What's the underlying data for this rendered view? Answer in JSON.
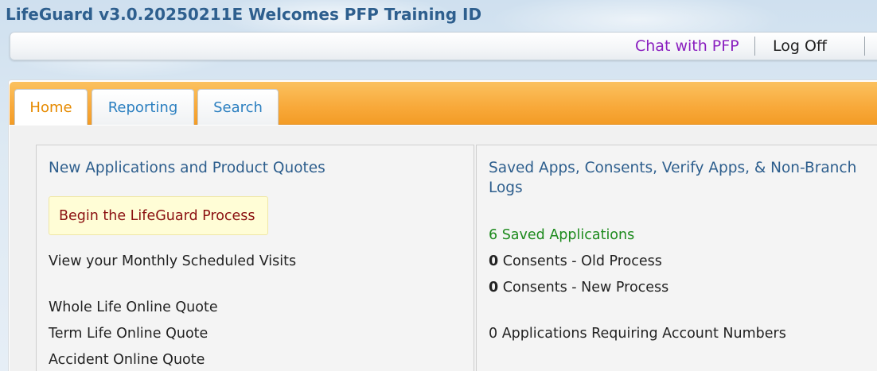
{
  "header": {
    "welcome": "LifeGuard v3.0.20250211E Welcomes PFP Training ID"
  },
  "topbar": {
    "chat_label": "Chat with PFP",
    "logoff_label": "Log Off"
  },
  "tabs": [
    {
      "label": "Home",
      "active": true
    },
    {
      "label": "Reporting",
      "active": false
    },
    {
      "label": "Search",
      "active": false
    }
  ],
  "left": {
    "title": "New Applications and Product Quotes",
    "begin_label": "Begin the LifeGuard Process",
    "links": [
      "View your Monthly Scheduled Visits",
      "Whole Life Online Quote",
      "Term Life Online Quote",
      "Accident Online Quote"
    ]
  },
  "right": {
    "title_line1": "Saved Apps, Consents, Verify Apps, & Non-Branch",
    "title_line2": "Logs",
    "saved_apps": "6 Saved Applications",
    "consents_old_count": "0",
    "consents_old_label": "Consents - Old Process",
    "consents_new_count": "0",
    "consents_new_label": "Consents - New Process",
    "account_numbers": "0 Applications Requiring Account Numbers"
  },
  "colors": {
    "accent_orange": "#f8a93a",
    "link_blue": "#2b7fc0",
    "title_blue": "#2d5e8d",
    "chat_purple": "#8a1fbf",
    "begin_red": "#8b1010",
    "saved_green": "#1d8a1d"
  }
}
